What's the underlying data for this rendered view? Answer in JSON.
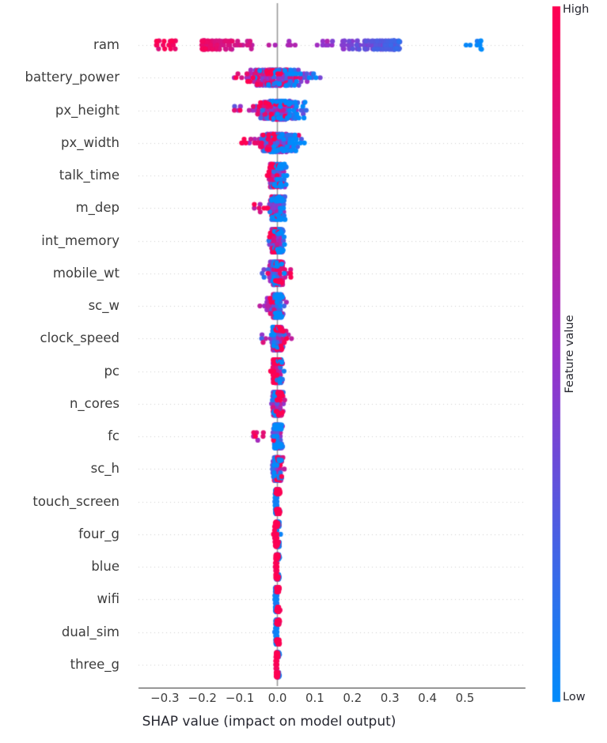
{
  "chart_data": {
    "type": "scatter",
    "plot_kind": "shap-beeswarm",
    "title": "",
    "xlabel": "SHAP value (impact on model output)",
    "ylabel": "",
    "xlim": [
      -0.345,
      0.565
    ],
    "xticks": [
      -0.3,
      -0.2,
      -0.1,
      0.0,
      0.1,
      0.2,
      0.3,
      0.4,
      0.5
    ],
    "xtick_labels": [
      "−0.3",
      "−0.2",
      "−0.1",
      "0.0",
      "0.1",
      "0.2",
      "0.3",
      "0.4",
      "0.5"
    ],
    "grid": "dotted-horizontal",
    "zero_line": 0.0,
    "legend": {
      "position": "right",
      "type": "colorbar",
      "title": "Feature value",
      "high_label": "High",
      "low_label": "Low",
      "high_color": "#ff0051",
      "low_color": "#008bfb",
      "mid_color": "#9b30c9"
    },
    "categories": [
      "ram",
      "battery_power",
      "px_height",
      "px_width",
      "talk_time",
      "m_dep",
      "int_memory",
      "mobile_wt",
      "sc_w",
      "clock_speed",
      "pc",
      "n_cores",
      "fc",
      "sc_h",
      "touch_screen",
      "four_g",
      "blue",
      "wifi",
      "dual_sim",
      "three_g"
    ],
    "series": [
      {
        "name": "ram",
        "n_points": 260,
        "shap_min": -0.325,
        "shap_max": 0.545,
        "spread": 0.215,
        "core_width": 0.3,
        "correlation": -1.0,
        "shape": "wide-bimodal",
        "jitter": 0.3,
        "mean_abs_shap": 0.186
      },
      {
        "name": "battery_power",
        "n_points": 220,
        "shap_min": -0.126,
        "shap_max": 0.128,
        "spread": 0.044,
        "core_width": 0.055,
        "correlation": -1.0,
        "shape": "dense-center",
        "jitter": 0.62,
        "mean_abs_shap": 0.039
      },
      {
        "name": "px_height",
        "n_points": 215,
        "shap_min": -0.118,
        "shap_max": 0.085,
        "spread": 0.036,
        "core_width": 0.045,
        "correlation": -1.0,
        "shape": "dense-center",
        "jitter": 0.72,
        "mean_abs_shap": 0.032
      },
      {
        "name": "px_width",
        "n_points": 210,
        "shap_min": -0.096,
        "shap_max": 0.072,
        "spread": 0.03,
        "core_width": 0.038,
        "correlation": -1.0,
        "shape": "dense-center",
        "jitter": 0.7,
        "mean_abs_shap": 0.027
      },
      {
        "name": "talk_time",
        "n_points": 200,
        "shap_min": -0.038,
        "shap_max": 0.025,
        "spread": 0.013,
        "core_width": 0.016,
        "correlation": -1.0,
        "shape": "star",
        "jitter": 0.86,
        "mean_abs_shap": 0.011
      },
      {
        "name": "m_dep",
        "n_points": 200,
        "shap_min": -0.062,
        "shap_max": 0.024,
        "spread": 0.012,
        "core_width": 0.015,
        "correlation": -1.0,
        "shape": "star-left-tail",
        "jitter": 0.86,
        "mean_abs_shap": 0.01
      },
      {
        "name": "int_memory",
        "n_points": 200,
        "shap_min": -0.03,
        "shap_max": 0.022,
        "spread": 0.011,
        "core_width": 0.013,
        "correlation": -1.0,
        "shape": "star",
        "jitter": 0.88,
        "mean_abs_shap": 0.009
      },
      {
        "name": "mobile_wt",
        "n_points": 200,
        "shap_min": -0.042,
        "shap_max": 0.04,
        "spread": 0.011,
        "core_width": 0.013,
        "correlation": 1.0,
        "shape": "star-two-tail",
        "jitter": 0.88,
        "mean_abs_shap": 0.009
      },
      {
        "name": "sc_w",
        "n_points": 200,
        "shap_min": -0.05,
        "shap_max": 0.024,
        "spread": 0.01,
        "core_width": 0.012,
        "correlation": -1.0,
        "shape": "star-left-tail",
        "jitter": 0.88,
        "mean_abs_shap": 0.008
      },
      {
        "name": "clock_speed",
        "n_points": 200,
        "shap_min": -0.046,
        "shap_max": 0.04,
        "spread": 0.01,
        "core_width": 0.012,
        "correlation": 1.0,
        "shape": "star-two-tail",
        "jitter": 0.88,
        "mean_abs_shap": 0.008
      },
      {
        "name": "pc",
        "n_points": 200,
        "shap_min": -0.026,
        "shap_max": 0.03,
        "spread": 0.009,
        "core_width": 0.011,
        "correlation": -1.0,
        "shape": "star",
        "jitter": 0.9,
        "mean_abs_shap": 0.008
      },
      {
        "name": "n_cores",
        "n_points": 200,
        "shap_min": -0.026,
        "shap_max": 0.022,
        "spread": 0.009,
        "core_width": 0.01,
        "correlation": 1.0,
        "shape": "star",
        "jitter": 0.9,
        "mean_abs_shap": 0.007
      },
      {
        "name": "fc",
        "n_points": 200,
        "shap_min": -0.082,
        "shap_max": 0.022,
        "spread": 0.008,
        "core_width": 0.01,
        "correlation": -1.0,
        "shape": "star-left-tail",
        "jitter": 0.9,
        "mean_abs_shap": 0.007
      },
      {
        "name": "sc_h",
        "n_points": 200,
        "shap_min": -0.02,
        "shap_max": 0.02,
        "spread": 0.008,
        "core_width": 0.009,
        "correlation": 1.0,
        "shape": "star",
        "jitter": 0.9,
        "mean_abs_shap": 0.006
      },
      {
        "name": "touch_screen",
        "n_points": 200,
        "shap_min": -0.012,
        "shap_max": 0.013,
        "spread": 0.005,
        "core_width": 0.006,
        "correlation": 1.0,
        "shape": "binary",
        "jitter": 0.95,
        "mean_abs_shap": 0.005
      },
      {
        "name": "four_g",
        "n_points": 200,
        "shap_min": -0.012,
        "shap_max": 0.012,
        "spread": 0.005,
        "core_width": 0.006,
        "correlation": -1.0,
        "shape": "binary",
        "jitter": 0.95,
        "mean_abs_shap": 0.004
      },
      {
        "name": "blue",
        "n_points": 200,
        "shap_min": -0.011,
        "shap_max": 0.011,
        "spread": 0.004,
        "core_width": 0.005,
        "correlation": -1.0,
        "shape": "binary",
        "jitter": 0.95,
        "mean_abs_shap": 0.004
      },
      {
        "name": "wifi",
        "n_points": 200,
        "shap_min": -0.01,
        "shap_max": 0.01,
        "spread": 0.004,
        "core_width": 0.005,
        "correlation": 1.0,
        "shape": "binary",
        "jitter": 0.95,
        "mean_abs_shap": 0.004
      },
      {
        "name": "dual_sim",
        "n_points": 200,
        "shap_min": -0.01,
        "shap_max": 0.01,
        "spread": 0.004,
        "core_width": 0.004,
        "correlation": 1.0,
        "shape": "binary",
        "jitter": 0.95,
        "mean_abs_shap": 0.003
      },
      {
        "name": "three_g",
        "n_points": 200,
        "shap_min": -0.009,
        "shap_max": 0.009,
        "spread": 0.003,
        "core_width": 0.004,
        "correlation": -1.0,
        "shape": "binary",
        "jitter": 0.95,
        "mean_abs_shap": 0.003
      }
    ]
  },
  "axes": {
    "x_title": "SHAP value (impact on model output)",
    "tick_labels": [
      "−0.3",
      "−0.2",
      "−0.1",
      "0.0",
      "0.1",
      "0.2",
      "0.3",
      "0.4",
      "0.5"
    ]
  },
  "colorbar": {
    "title": "Feature value",
    "high": "High",
    "low": "Low"
  }
}
